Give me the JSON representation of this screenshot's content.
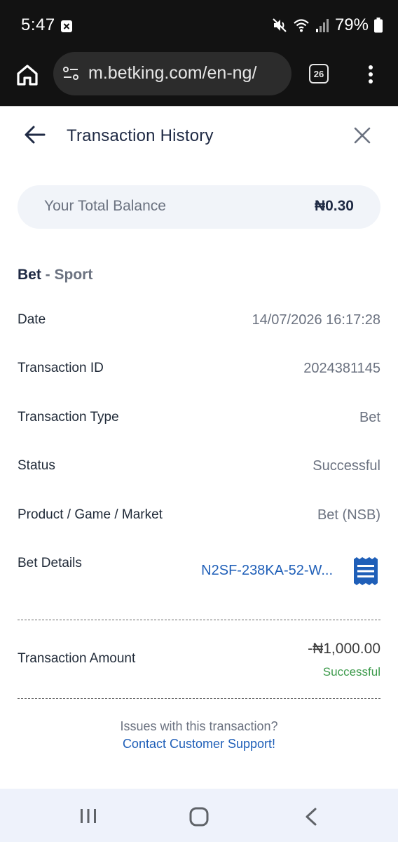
{
  "status_bar": {
    "time": "5:47",
    "battery": "79%",
    "icons": [
      "notification-close-icon",
      "mute-icon",
      "wifi-icon",
      "signal-icon",
      "battery-icon"
    ]
  },
  "browser": {
    "url": "m.betking.com/en-ng/",
    "tab_count": "26",
    "icons": [
      "home-icon",
      "site-settings-icon",
      "tabs-icon",
      "more-vert-icon"
    ]
  },
  "header": {
    "title": "Transaction History"
  },
  "balance": {
    "label": "Your Total Balance",
    "value": "₦0.30"
  },
  "section": {
    "title_main": "Bet",
    "title_sub": " - Sport"
  },
  "details": {
    "date_label": "Date",
    "date_value": "14/07/2026 16:17:28",
    "txn_id_label": "Transaction ID",
    "txn_id_value": "2024381145",
    "txn_type_label": "Transaction Type",
    "txn_type_value": "Bet",
    "status_label": "Status",
    "status_value": "Successful",
    "product_label": "Product / Game / Market",
    "product_value": "Bet (NSB)",
    "bet_details_label": "Bet Details",
    "bet_details_value": "N2SF-238KA-52-W..."
  },
  "amount": {
    "label": "Transaction Amount",
    "value": "-₦1,000.00",
    "status": "Successful"
  },
  "support": {
    "question": "Issues with this transaction?",
    "link": "Contact Customer Support!"
  },
  "colors": {
    "accent_blue": "#1f5fb8",
    "success_green": "#3c9a4b",
    "title_navy": "#1f2a44",
    "balance_bg": "#f1f4f9"
  }
}
